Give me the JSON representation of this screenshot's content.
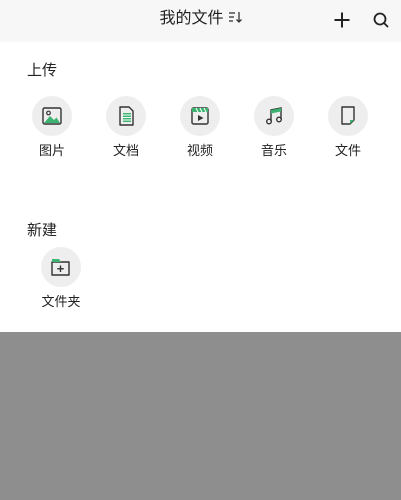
{
  "header": {
    "title": "我的文件",
    "sort_icon": "sort-icon",
    "add_icon": "plus-icon",
    "search_icon": "search-icon"
  },
  "upload": {
    "title": "上传",
    "items": [
      {
        "label": "图片",
        "icon": "image-icon"
      },
      {
        "label": "文档",
        "icon": "document-icon"
      },
      {
        "label": "视频",
        "icon": "video-icon"
      },
      {
        "label": "音乐",
        "icon": "music-icon"
      },
      {
        "label": "文件",
        "icon": "file-icon"
      }
    ]
  },
  "create": {
    "title": "新建",
    "items": [
      {
        "label": "文件夹",
        "icon": "folder-add-icon"
      }
    ]
  },
  "colors": {
    "accent_green": "#3cb371",
    "icon_dark": "#333333",
    "circle_bg": "#eeeeee",
    "overlay": "#8e8e8e"
  }
}
